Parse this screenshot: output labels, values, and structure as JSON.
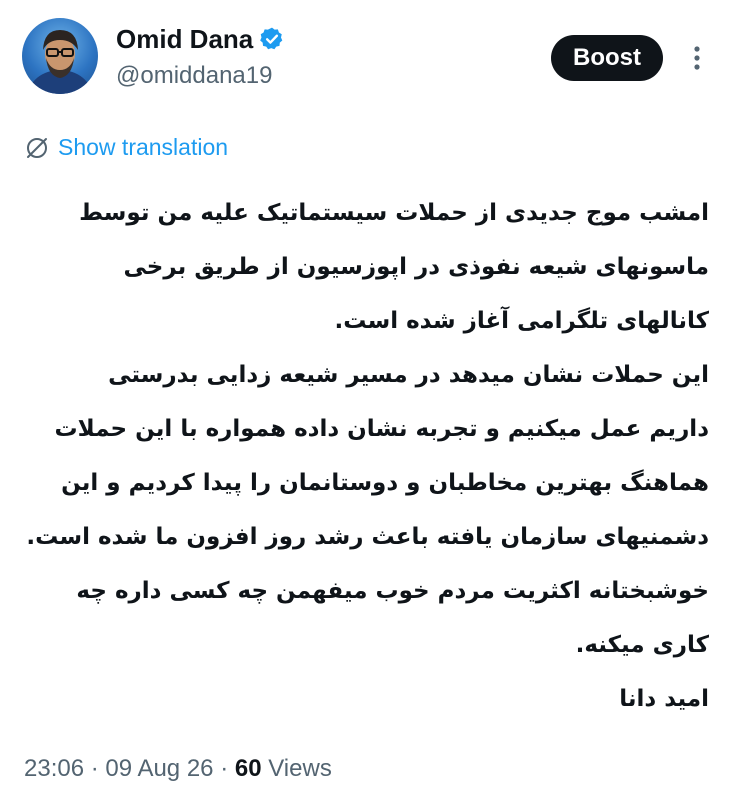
{
  "user": {
    "display_name": "Omid Dana",
    "handle": "@omiddana19",
    "verified_icon": "verified-badge-icon"
  },
  "actions": {
    "boost_label": "Boost",
    "more_icon": "more-vertical-icon"
  },
  "translation": {
    "label": "Show translation",
    "icon": "translate-icon"
  },
  "tweet": {
    "lines": [
      "امشب موج جدیدی از حملات سیستماتیک علیه من توسط",
      "ماسونهای شیعه نفوذی در اپوزسیون از طریق برخی",
      "کانالهای تلگرامی آغاز شده است.",
      "این حملات نشان میدهد در مسیر شیعه زدایی بدرستی",
      "داریم عمل میکنیم و تجربه نشان داده همواره با این حملات",
      "هماهنگ بهترین مخاطبان و دوستانمان را پیدا کردیم و این",
      "دشمنیهای سازمان یافته باعث رشد روز افزون ما شده است.",
      "خوشبختانه اکثریت مردم خوب میفهمن چه کسی داره چه",
      "کاری میکنه.",
      "امید دانا"
    ]
  },
  "meta": {
    "time": "23:06",
    "sep1": "·",
    "date": "09 Aug 26",
    "sep2": "·",
    "views_count": "60",
    "views_label": "Views"
  },
  "colors": {
    "accent": "#1d9bf0",
    "text": "#0f1419",
    "muted": "#536471",
    "button_bg": "#0f1419"
  }
}
